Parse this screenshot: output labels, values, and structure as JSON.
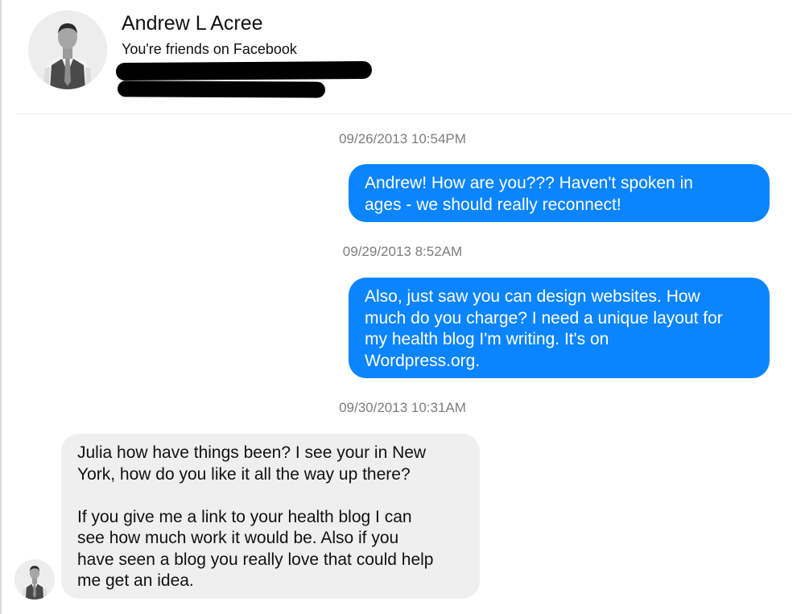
{
  "header": {
    "contact_name": "Andrew L Acree",
    "friend_status": "You're friends on Facebook",
    "avatar_icon": "person-avatar-icon"
  },
  "colors": {
    "outgoing_bubble": "#0a84ff",
    "incoming_bubble": "#efefef",
    "timestamp_text": "#7d7d7d"
  },
  "conversation": {
    "timestamps": [
      "09/26/2013 10:54PM",
      "09/29/2013 8:52AM",
      "09/30/2013 10:31AM"
    ],
    "messages": [
      {
        "direction": "outgoing",
        "text": "Andrew! How are you??? Haven't spoken in\nages - we should really reconnect!"
      },
      {
        "direction": "outgoing",
        "text": "Also, just saw you can design websites. How\nmuch do you charge? I need a unique layout for\nmy health blog I'm writing. It's on\nWordpress.org."
      },
      {
        "direction": "incoming",
        "text": "Julia how have things been? I see your in New\nYork, how do you like it all the way up there?\n\nIf you give me a link to your health blog I can\nsee how much work it would be. Also if you\nhave seen a blog you really love that could help\nme get an idea."
      }
    ]
  }
}
